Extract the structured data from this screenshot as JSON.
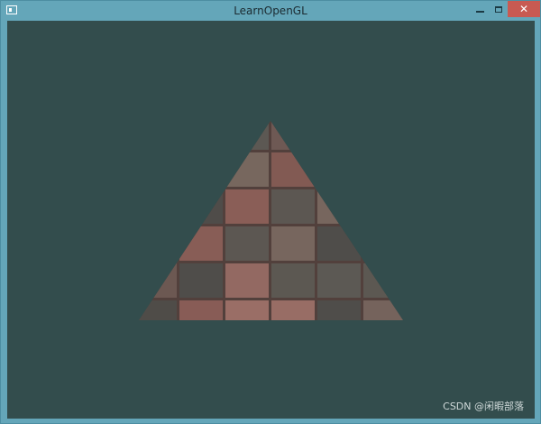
{
  "window": {
    "title": "LearnOpenGL",
    "close_glyph": "✕"
  },
  "scene": {
    "clear_color": "#334d4d",
    "object": "textured triangle",
    "texture": "brick tile wall",
    "texture_colors": [
      "#6f5a55",
      "#8a5e57",
      "#5d5a55",
      "#7b6a62",
      "#4f4e4b",
      "#9a6e66"
    ]
  },
  "watermark": {
    "text": "CSDN @闲暇部落"
  },
  "icons": {
    "app": "app-window-icon",
    "minimize": "minimize-icon",
    "maximize": "maximize-icon",
    "close": "close-icon"
  }
}
